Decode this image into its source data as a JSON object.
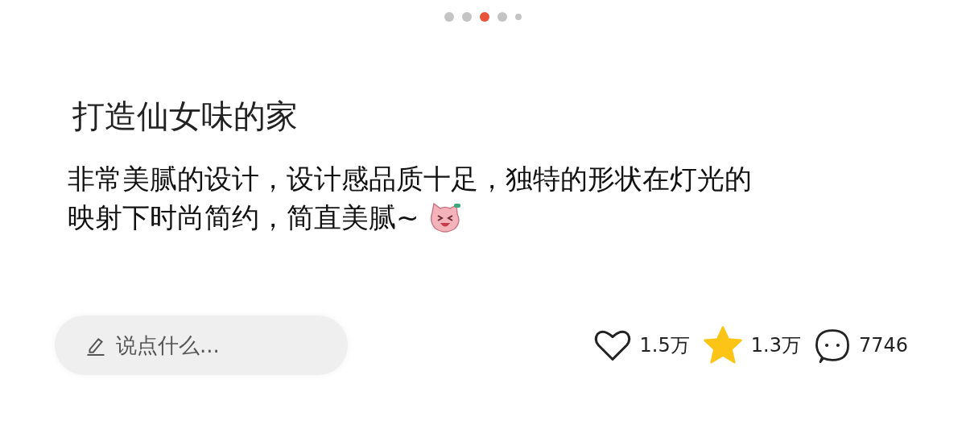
{
  "carousel_dots": [
    {
      "selected": false
    },
    {
      "selected": false
    },
    {
      "selected": true
    },
    {
      "selected": false
    },
    {
      "selected": false
    }
  ],
  "post": {
    "title": "打造仙女味的家",
    "body_lines": [
      "非常美腻的设计，设计感品质十足，独特的形状在灯光的",
      "映射下时尚简约，简直美腻~"
    ]
  },
  "comment_field": {
    "placeholder": "说点什么..."
  },
  "actions": [
    {
      "kind": "like",
      "count": "1.5万",
      "active": false
    },
    {
      "kind": "collect",
      "count": "1.3万",
      "active": true
    },
    {
      "kind": "comment",
      "count": "7746"
    }
  ]
}
